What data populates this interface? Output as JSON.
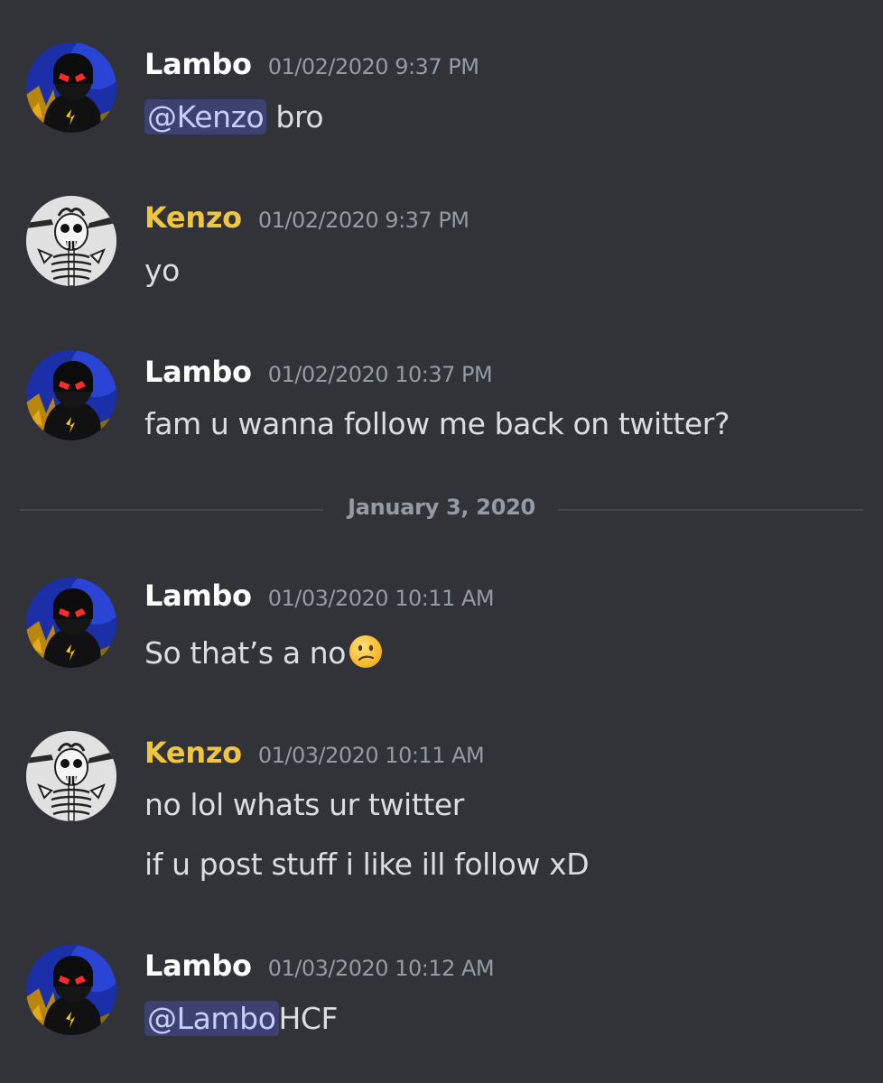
{
  "colors": {
    "background": "#313338",
    "lambo_name": "#ffffff",
    "kenzo_name": "#f0c541",
    "timestamp": "#949ba4",
    "message_text": "#dbdee1",
    "mention_bg": "#4b4f87",
    "mention_text": "#c9cdfb"
  },
  "date_divider": "January 3, 2020",
  "messages": [
    {
      "author": "Lambo",
      "timestamp": "01/02/2020 9:37 PM",
      "avatar_icon": "dark-hooded-character-avatar",
      "lines": [
        {
          "mention": "@Kenzo",
          "text": " bro"
        }
      ]
    },
    {
      "author": "Kenzo",
      "timestamp": "01/02/2020 9:37 PM",
      "avatar_icon": "skeleton-avatar",
      "lines": [
        {
          "text": "yo"
        }
      ]
    },
    {
      "author": "Lambo",
      "timestamp": "01/02/2020 10:37 PM",
      "avatar_icon": "dark-hooded-character-avatar",
      "lines": [
        {
          "text": "fam u wanna follow me back on twitter?"
        }
      ]
    },
    {
      "author": "Lambo",
      "timestamp": "01/03/2020 10:11 AM",
      "avatar_icon": "dark-hooded-character-avatar",
      "lines": [
        {
          "text": "So that’s a no",
          "emoji": "confused-face-emoji"
        }
      ]
    },
    {
      "author": "Kenzo",
      "timestamp": "01/03/2020 10:11 AM",
      "avatar_icon": "skeleton-avatar",
      "lines": [
        {
          "text": "no lol whats ur twitter"
        },
        {
          "text": "if u post stuff i like ill follow xD"
        }
      ]
    },
    {
      "author": "Lambo",
      "timestamp": "01/03/2020 10:12 AM",
      "avatar_icon": "dark-hooded-character-avatar",
      "lines": [
        {
          "mention": "@Lambo",
          "text": "HCF"
        }
      ]
    }
  ]
}
